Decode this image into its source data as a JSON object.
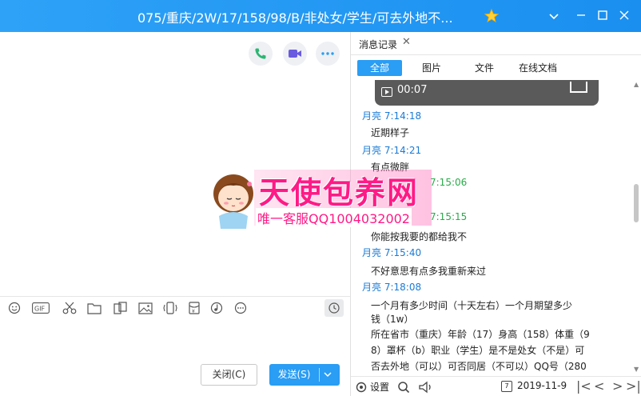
{
  "window": {
    "title": "075/重庆/2W/17/158/98/B/非处女/学生/可去外地不...",
    "controls": [
      "chevron-down",
      "minimize",
      "maximize",
      "close"
    ]
  },
  "chat_header": {
    "actions": [
      {
        "name": "phone-call",
        "color": "#2bb673"
      },
      {
        "name": "video-call",
        "color": "#6a5ae0"
      },
      {
        "name": "more",
        "color": "#2a9df4"
      }
    ]
  },
  "watermark": {
    "big_text": "天使包养网",
    "small_text": "唯一客服QQ1004032002"
  },
  "toolbar": {
    "tools": [
      "emoji-icon",
      "gif-icon",
      "scissors-icon",
      "folder-icon",
      "sticker-icon",
      "image-icon",
      "shake-icon",
      "red-packet-icon",
      "music-icon",
      "more-icon"
    ],
    "history_icon": "clock-icon"
  },
  "buttons": {
    "close_label": "关闭(C)",
    "send_label": "发送(S)"
  },
  "history": {
    "tab_title": "消息记录",
    "filters": [
      "全部",
      "图片",
      "文件",
      "在线文档"
    ],
    "active_filter": "全部",
    "video_duration": "00:07",
    "messages": [
      {
        "sender": "月亮",
        "time": "7:14:18",
        "text": "近期样子",
        "color": "blue"
      },
      {
        "sender": "月亮",
        "time": "7:14:21",
        "text": "有点微胖",
        "color": "blue"
      },
      {
        "sender": "",
        "time": "7:15:06",
        "text": "",
        "color": "green"
      },
      {
        "sender": "",
        "time": "7:15:15",
        "text": "你能按我要的都给我不",
        "color": "green"
      },
      {
        "sender": "月亮",
        "time": "7:15:40",
        "text": "不好意思有点多我重新来过",
        "color": "blue"
      },
      {
        "sender": "月亮",
        "time": "7:18:08",
        "text": "",
        "color": "blue"
      }
    ],
    "long_message_lines": [
      "一个月有多少时间（十天左右）一个月期望多少",
      "钱（1w）",
      "所在省市（重庆）年龄（17）身高（158）体重（9",
      "8）罩杯（b）职业（学生）是不是处女（不是）可",
      "否去外地（可以）可否同居（不可以）QQ号（280"
    ],
    "bottom": {
      "settings_label": "设置",
      "date": "2019-11-9"
    }
  }
}
